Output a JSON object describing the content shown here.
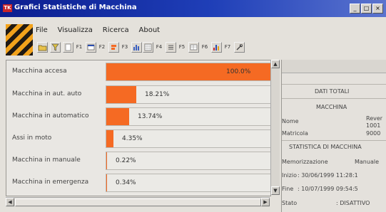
{
  "window": {
    "icon_text": "TK",
    "title": "Grafici Statistiche di Macchina",
    "controls": [
      "_",
      "□",
      "×"
    ]
  },
  "menu": [
    "File",
    "Visualizza",
    "Ricerca",
    "About"
  ],
  "toolbar": {
    "f1": "F1",
    "f2": "F2",
    "f3": "F3",
    "f4": "F4",
    "f5": "F5",
    "f6": "F6",
    "f7": "F7"
  },
  "stats": [
    {
      "label": "Macchina accesa",
      "value": "100.0%",
      "fraction": 1.0
    },
    {
      "label": "Macchina in aut. auto",
      "value": "18.21%",
      "fraction": 0.1821
    },
    {
      "label": "Macchina in automatico",
      "value": "13.74%",
      "fraction": 0.1374
    },
    {
      "label": "Assi in moto",
      "value": "4.35%",
      "fraction": 0.0435
    },
    {
      "label": "Macchina in manuale",
      "value": "0.22%",
      "fraction": 0.0022
    },
    {
      "label": "Macchina in emergenza",
      "value": "0.34%",
      "fraction": 0.0034
    }
  ],
  "totals": {
    "heading": "DATI TOTALI",
    "machine_heading": "MACCHINA",
    "name_label": "Nome",
    "name_value": "Rever",
    "name_value2": "1001",
    "serial_label": "Matricola",
    "serial_value": "9000",
    "stat_heading": "STATISTICA DI MACCHINA",
    "memo_label": "Memorizzazione",
    "memo_value": "Manuale",
    "start_label": "Inizio",
    "start_value": ": 30/06/1999  11:28:1",
    "end_label": "Fine",
    "end_value": ": 10/07/1999  09:54:5",
    "state_label": "Stato",
    "state_value": ": DISATTIVO"
  },
  "colors": {
    "titlebar": "#0b1d8f",
    "bar_fill": "#f56a23",
    "panel_bg": "#e9e7e3"
  }
}
